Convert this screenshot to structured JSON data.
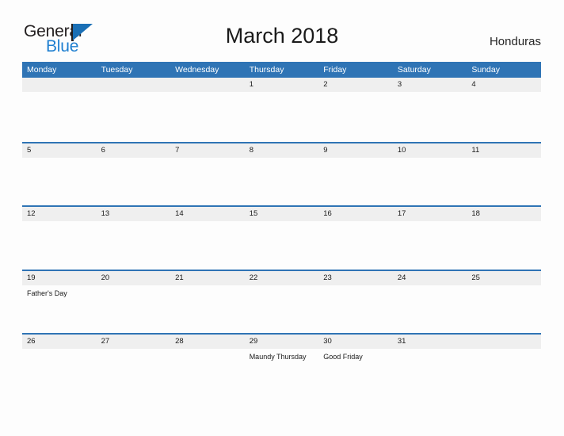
{
  "brand": {
    "name_part1": "General",
    "name_part2": "Blue",
    "logo_icon": "triangle-flag-icon",
    "color_dark": "#231f20",
    "color_blue": "#1f7fd0"
  },
  "header": {
    "title": "March 2018",
    "country": "Honduras"
  },
  "theme": {
    "header_blue": "#2f74b5",
    "row_border_blue": "#2f74b5",
    "date_strip_gray": "#efefef",
    "background": "#fdfdfd",
    "text_dark": "#1a1a1a"
  },
  "calendar": {
    "day_headers": [
      "Monday",
      "Tuesday",
      "Wednesday",
      "Thursday",
      "Friday",
      "Saturday",
      "Sunday"
    ],
    "weeks": [
      {
        "days": [
          {
            "date": "",
            "event": ""
          },
          {
            "date": "",
            "event": ""
          },
          {
            "date": "",
            "event": ""
          },
          {
            "date": "1",
            "event": ""
          },
          {
            "date": "2",
            "event": ""
          },
          {
            "date": "3",
            "event": ""
          },
          {
            "date": "4",
            "event": ""
          }
        ]
      },
      {
        "days": [
          {
            "date": "5",
            "event": ""
          },
          {
            "date": "6",
            "event": ""
          },
          {
            "date": "7",
            "event": ""
          },
          {
            "date": "8",
            "event": ""
          },
          {
            "date": "9",
            "event": ""
          },
          {
            "date": "10",
            "event": ""
          },
          {
            "date": "11",
            "event": ""
          }
        ]
      },
      {
        "days": [
          {
            "date": "12",
            "event": ""
          },
          {
            "date": "13",
            "event": ""
          },
          {
            "date": "14",
            "event": ""
          },
          {
            "date": "15",
            "event": ""
          },
          {
            "date": "16",
            "event": ""
          },
          {
            "date": "17",
            "event": ""
          },
          {
            "date": "18",
            "event": ""
          }
        ]
      },
      {
        "days": [
          {
            "date": "19",
            "event": "Father's Day"
          },
          {
            "date": "20",
            "event": ""
          },
          {
            "date": "21",
            "event": ""
          },
          {
            "date": "22",
            "event": ""
          },
          {
            "date": "23",
            "event": ""
          },
          {
            "date": "24",
            "event": ""
          },
          {
            "date": "25",
            "event": ""
          }
        ]
      },
      {
        "days": [
          {
            "date": "26",
            "event": ""
          },
          {
            "date": "27",
            "event": ""
          },
          {
            "date": "28",
            "event": ""
          },
          {
            "date": "29",
            "event": "Maundy Thursday"
          },
          {
            "date": "30",
            "event": "Good Friday"
          },
          {
            "date": "31",
            "event": ""
          },
          {
            "date": "",
            "event": ""
          }
        ]
      }
    ]
  }
}
